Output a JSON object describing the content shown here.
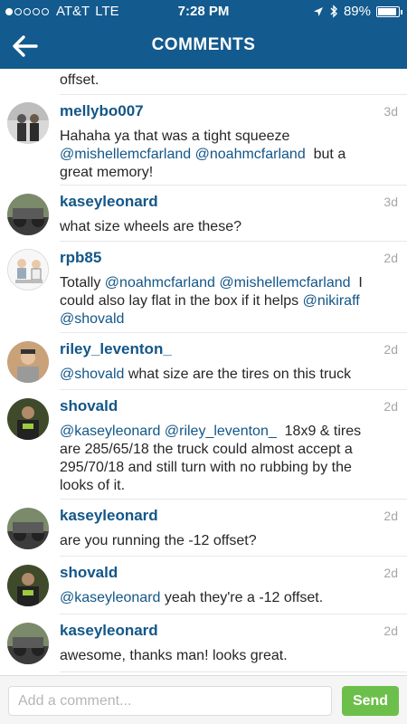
{
  "status_bar": {
    "carrier": "AT&T",
    "network": "LTE",
    "time": "7:28 PM",
    "battery": "89%",
    "battery_level": 0.89
  },
  "header": {
    "title": "COMMENTS"
  },
  "partial_comment": {
    "body": "offset."
  },
  "comments": [
    {
      "username": "mellybo007",
      "time": "3d",
      "body_lines": [
        {
          "t": "Hahaha ya that was a tight squeeze"
        },
        {
          "m1": "@mishellemcfarland",
          "s1": " ",
          "m2": "@noahmcfarland",
          "t2": "  but a"
        },
        {
          "t": "great memory!"
        }
      ]
    },
    {
      "username": "kaseyleonard",
      "time": "3d",
      "body_lines": [
        {
          "t": "what size wheels are these?"
        }
      ]
    },
    {
      "username": "rpb85",
      "time": "2d",
      "body_lines": [
        {
          "t1": "Totally ",
          "m1": "@noahmcfarland",
          "s1": " ",
          "m2": "@mishellemcfarland",
          "t2": "  I"
        },
        {
          "t1": "could also lay flat in the box if it helps ",
          "m1": "@nikiraff"
        },
        {
          "m1": "@shovald"
        }
      ]
    },
    {
      "username": "riley_leventon_",
      "time": "2d",
      "body_lines": [
        {
          "m1": "@shovald",
          "t2": " what size are the tires on this truck"
        }
      ]
    },
    {
      "username": "shovald",
      "time": "2d",
      "body_lines": [
        {
          "m1": "@kaseyleonard",
          "s1": " ",
          "m2": "@riley_leventon_",
          "t2": "  18x9 & tires"
        },
        {
          "t": "are 285/65/18 the truck could almost accept a"
        },
        {
          "t": "295/70/18 and still turn with no rubbing by the"
        },
        {
          "t": "looks of it."
        }
      ]
    },
    {
      "username": "kaseyleonard",
      "time": "2d",
      "body_lines": [
        {
          "t": "are you running the -12 offset?"
        }
      ]
    },
    {
      "username": "shovald",
      "time": "2d",
      "body_lines": [
        {
          "m1": "@kaseyleonard",
          "t2": " yeah they're a -12 offset."
        }
      ]
    },
    {
      "username": "kaseyleonard",
      "time": "2d",
      "body_lines": [
        {
          "t": "awesome, thanks man! looks great."
        }
      ]
    }
  ],
  "composer": {
    "placeholder": "Add a comment...",
    "send_label": "Send"
  },
  "colors": {
    "header_bg": "#135a8e",
    "username": "#125688",
    "send_bg": "#6dbf4b"
  }
}
